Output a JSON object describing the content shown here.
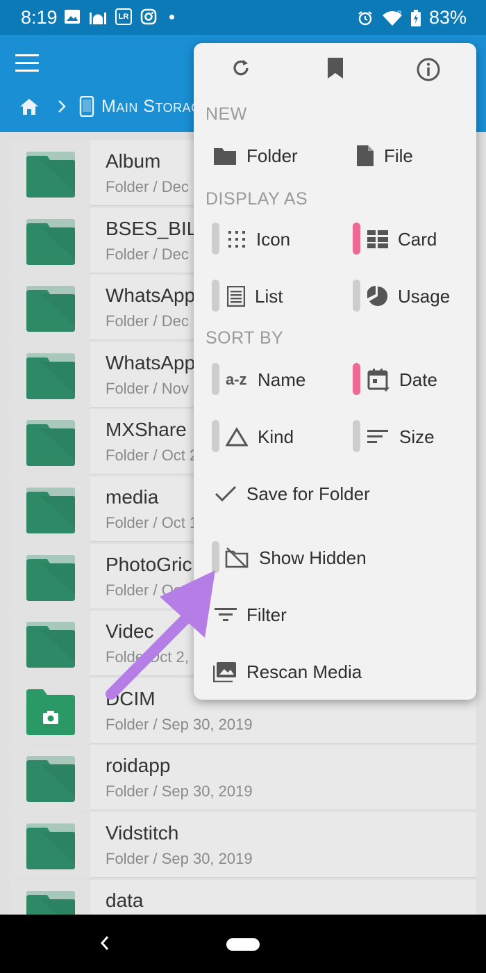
{
  "status_bar": {
    "time": "8:19",
    "lr_badge": "LR",
    "battery": "83%",
    "signal_badge": "R"
  },
  "toolbar": {
    "breadcrumb_location": "Main Storage"
  },
  "files": [
    {
      "name": "Album",
      "meta": "Folder / Dec 2",
      "type": "folder"
    },
    {
      "name": "BSES_BIL",
      "meta": "Folder / Dec 1",
      "type": "folder"
    },
    {
      "name": "WhatsApp",
      "meta": "Folder / Dec 6",
      "type": "folder"
    },
    {
      "name": "WhatsApp",
      "meta": "Folder / Nov 1",
      "type": "folder"
    },
    {
      "name": "MXShare",
      "meta": "Folder / Oct 2",
      "type": "folder"
    },
    {
      "name": "media",
      "meta": "Folder / Oct 14",
      "type": "folder"
    },
    {
      "name": "PhotoGric",
      "meta": "Folder / Oct 2",
      "type": "folder"
    },
    {
      "name": "Videc",
      "meta": "Folde  Oct 2,",
      "type": "folder"
    },
    {
      "name": "DCIM",
      "meta": "Folder / Sep 30, 2019",
      "type": "camera-folder"
    },
    {
      "name": "roidapp",
      "meta": "Folder / Sep 30, 2019",
      "type": "folder"
    },
    {
      "name": "Vidstitch",
      "meta": "Folder / Sep 30, 2019",
      "type": "folder"
    },
    {
      "name": "data",
      "meta": "",
      "type": "folder"
    }
  ],
  "menu": {
    "top_icons": [
      "refresh-icon",
      "bookmark-icon",
      "info-icon"
    ],
    "new_header": "NEW",
    "new_folder": "Folder",
    "new_file": "File",
    "display_header": "DISPLAY AS",
    "display_icon": "Icon",
    "display_card": "Card",
    "display_list": "List",
    "display_usage": "Usage",
    "sort_header": "SORT BY",
    "sort_name": "Name",
    "sort_date": "Date",
    "sort_kind": "Kind",
    "sort_size": "Size",
    "az_glyph": "a-z",
    "save_for_folder": "Save for Folder",
    "show_hidden": "Show Hidden",
    "filter": "Filter",
    "rescan_media": "Rescan Media",
    "selected": {
      "display": "Card",
      "sort": "Date"
    }
  },
  "colors": {
    "status_bar": "#0d7ab8",
    "toolbar": "#1a8fd4",
    "folder": "#2e8a66",
    "toggle_on": "#ec6a95",
    "arrow": "#b47ee6"
  }
}
